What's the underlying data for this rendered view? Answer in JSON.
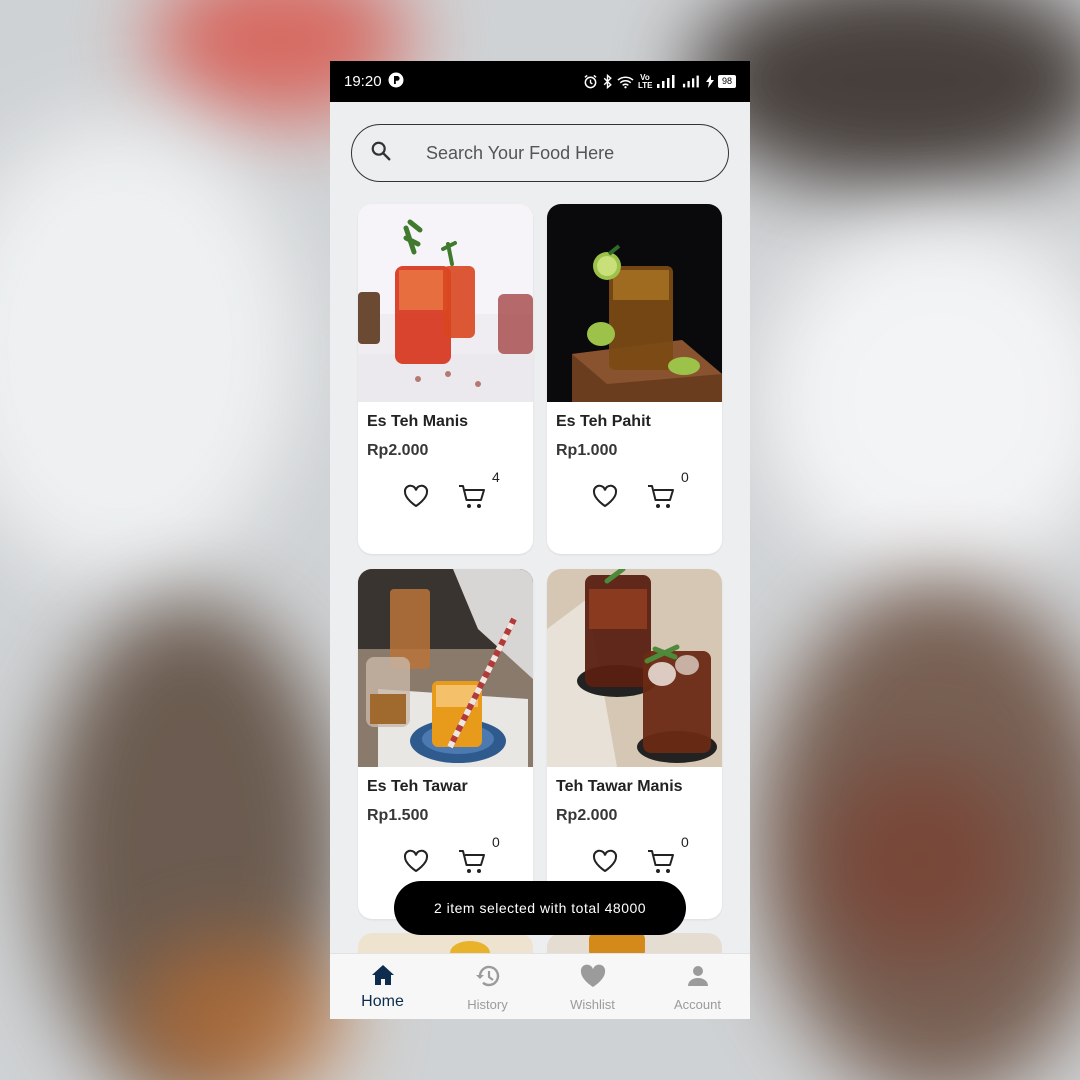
{
  "status_bar": {
    "time": "19:20",
    "volte": "Vo LTE",
    "battery": "98"
  },
  "search": {
    "placeholder": "Search Your Food Here"
  },
  "products": [
    {
      "name": "Es Teh Manis",
      "price": "Rp2.000",
      "cart_count": "4"
    },
    {
      "name": "Es Teh Pahit",
      "price": "Rp1.000",
      "cart_count": "0"
    },
    {
      "name": "Es Teh Tawar",
      "price": "Rp1.500",
      "cart_count": "0"
    },
    {
      "name": "Teh Tawar Manis",
      "price": "Rp2.000",
      "cart_count": "0"
    }
  ],
  "toast": {
    "text": "2 item selected with total 48000"
  },
  "bottom_nav": {
    "items": [
      {
        "label": "Home",
        "icon": "home-icon",
        "active": true
      },
      {
        "label": "History",
        "icon": "history-icon",
        "active": false
      },
      {
        "label": "Wishlist",
        "icon": "heart-icon",
        "active": false
      },
      {
        "label": "Account",
        "icon": "person-icon",
        "active": false
      }
    ]
  },
  "colors": {
    "active_nav": "#0e2c4e",
    "inactive_nav": "#9b9b9b",
    "toast_bg": "#000000",
    "screen_bg": "#eceef0"
  }
}
